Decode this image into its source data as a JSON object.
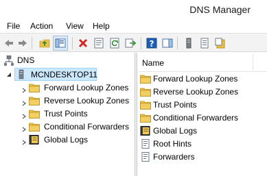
{
  "window": {
    "title": "DNS Manager"
  },
  "menu": [
    "File",
    "Action",
    "View",
    "Help"
  ],
  "toolbar": {
    "buttons": [
      "back-arrow-icon",
      "forward-arrow-icon",
      "up-folder-icon",
      "show-hide-tree-icon",
      "delete-icon",
      "properties-icon",
      "refresh-icon",
      "export-list-icon",
      "help-icon",
      "action-pane-icon",
      "server-icon",
      "list-icon",
      "new-record-icon"
    ]
  },
  "tree": {
    "root": "DNS",
    "server": "MCNDESKTOP11",
    "children": [
      "Forward Lookup Zones",
      "Reverse Lookup Zones",
      "Trust Points",
      "Conditional Forwarders",
      "Global Logs"
    ]
  },
  "list": {
    "column": "Name",
    "items": [
      {
        "name": "Forward Lookup Zones",
        "icon": "folder-icon"
      },
      {
        "name": "Reverse Lookup Zones",
        "icon": "folder-icon"
      },
      {
        "name": "Trust Points",
        "icon": "folder-icon"
      },
      {
        "name": "Conditional Forwarders",
        "icon": "folder-icon"
      },
      {
        "name": "Global Logs",
        "icon": "log-book-icon"
      },
      {
        "name": "Root Hints",
        "icon": "page-icon"
      },
      {
        "name": "Forwarders",
        "icon": "page-icon"
      }
    ]
  },
  "colors": {
    "folder": "#e8c04a",
    "selection": "#cce8ff",
    "toolbar_bg": "#f3f3f3"
  }
}
